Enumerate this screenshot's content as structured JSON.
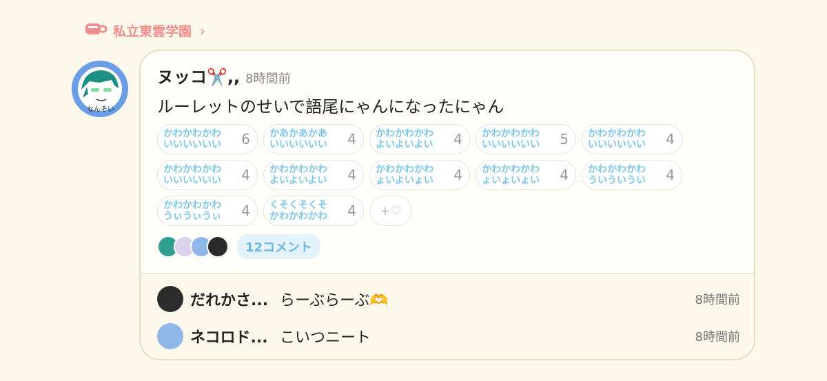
{
  "group": {
    "name": "私立東雲学園",
    "icon": "teacup-icon",
    "chevron": "›"
  },
  "post": {
    "author": "ヌッコ✂️,,",
    "time": "8時間前",
    "text": "ルーレットのせいで語尾にゃんになったにゃん",
    "reactions": [
      {
        "line1": "かわかわかわ",
        "line2": "いいいいいい",
        "count": "6"
      },
      {
        "line1": "かあかあかあ",
        "line2": "いいいいいい",
        "count": "4"
      },
      {
        "line1": "かわかわかわ",
        "line2": "よいよいよい",
        "count": "4"
      },
      {
        "line1": "かわかわかわ",
        "line2": "いいいいいい",
        "count": "5"
      },
      {
        "line1": "かわかわかわ",
        "line2": "いいいいいい",
        "count": "4"
      },
      {
        "line1": "かわかわかわ",
        "line2": "いいいいいい",
        "count": "4"
      },
      {
        "line1": "かわかわかわ",
        "line2": "よいよいよい",
        "count": "4"
      },
      {
        "line1": "かわかわかわ",
        "line2": "ょいよいょい",
        "count": "4"
      },
      {
        "line1": "かわかわかわ",
        "line2": "ょいょいょい",
        "count": "4"
      },
      {
        "line1": "かわかわかわ",
        "line2": "ういういうい",
        "count": "4"
      },
      {
        "line1": "かわかわかわ",
        "line2": "うぃうぃうぃ",
        "count": "4"
      },
      {
        "line1": "くそくそくそ",
        "line2": "かわかわかわ",
        "count": "4"
      }
    ],
    "add_reaction": "+♡",
    "comment_count": "12コメント"
  },
  "comments": [
    {
      "name": "だれかさ...",
      "text": "らーぶらーぶ🫶",
      "time": "8時間前"
    },
    {
      "name": "ネコロド...",
      "text": "こいつニート",
      "time": "8時間前"
    }
  ],
  "colors": {
    "accent_pink": "#ef8c8c",
    "reaction_text": "#7ec6ea",
    "card_border": "#e2dfc6"
  }
}
